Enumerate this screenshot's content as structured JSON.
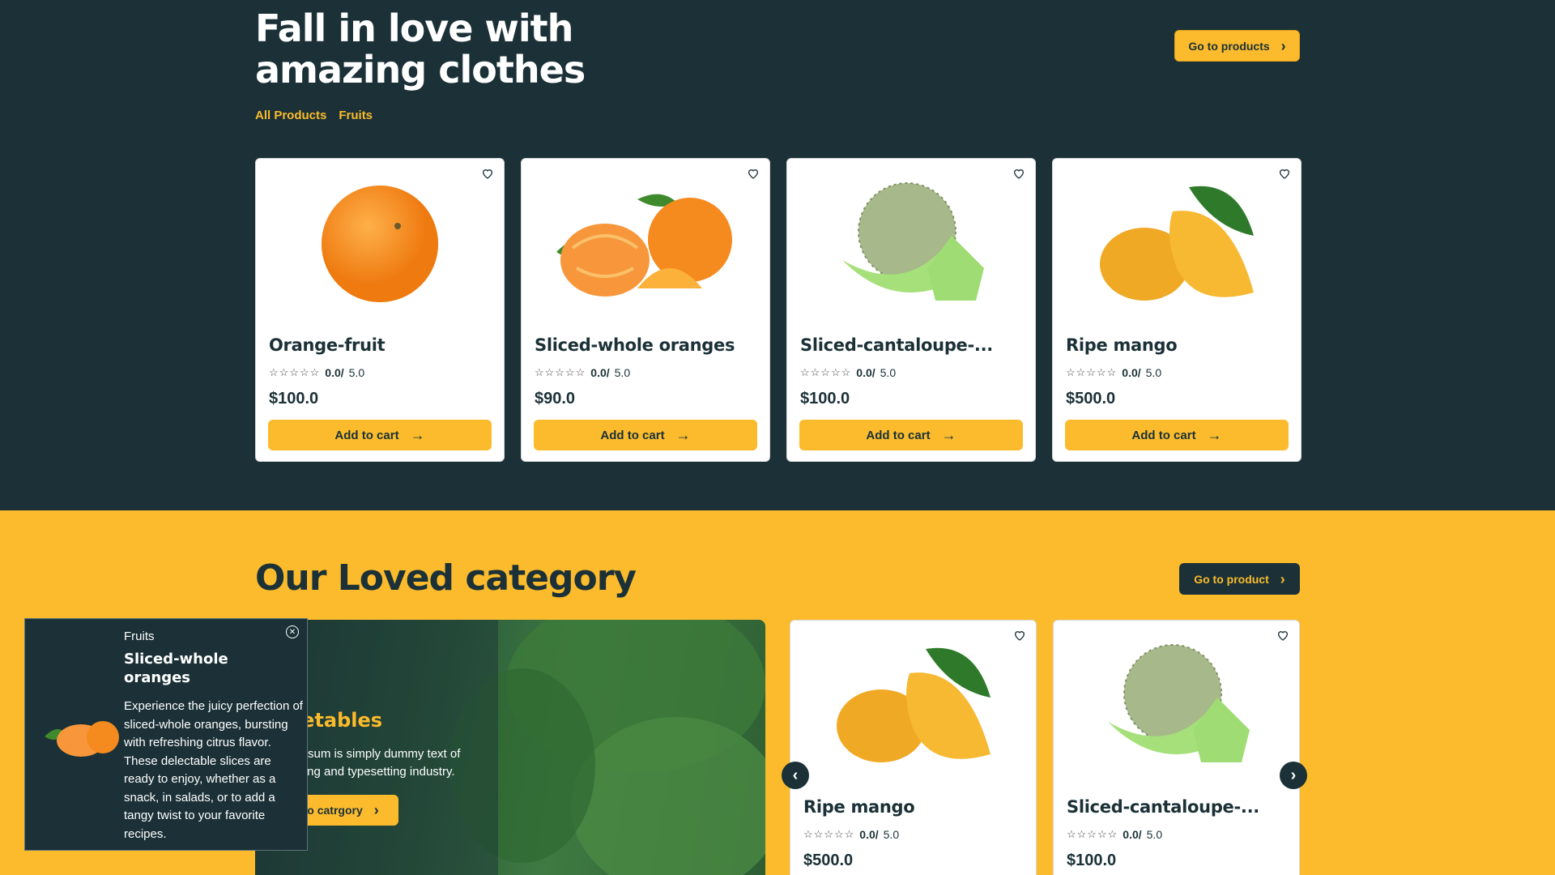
{
  "hero": {
    "title": "Fall in love with amazing clothes",
    "go_button": "Go to products",
    "filters": [
      "All Products",
      "Fruits"
    ]
  },
  "products": [
    {
      "name": "Orange-fruit",
      "stars": "☆☆☆☆☆",
      "rating": "0.0/",
      "rating_max": "5.0",
      "price": "$100.0",
      "button": "Add to cart",
      "image": "orange-image"
    },
    {
      "name": "Sliced-whole oranges",
      "stars": "☆☆☆☆☆",
      "rating": "0.0/",
      "rating_max": "5.0",
      "price": "$90.0",
      "button": "Add to cart",
      "image": "sliced-oranges-image"
    },
    {
      "name": "Sliced-cantaloupe-...",
      "stars": "☆☆☆☆☆",
      "rating": "0.0/",
      "rating_max": "5.0",
      "price": "$100.0",
      "button": "Add to cart",
      "image": "cantaloupe-image"
    },
    {
      "name": "Ripe mango",
      "stars": "☆☆☆☆☆",
      "rating": "0.0/",
      "rating_max": "5.0",
      "price": "$500.0",
      "button": "Add to cart",
      "image": "mango-image"
    }
  ],
  "category": {
    "title": "Our Loved category",
    "go_button": "Go to product",
    "banner": {
      "title": "getables",
      "text": "n Ipsum is simply dummy text of rinting and typesetting industry.",
      "button": "o catrgory"
    },
    "items": [
      {
        "name": "Ripe mango",
        "stars": "☆☆☆☆☆",
        "rating": "0.0/",
        "rating_max": "5.0",
        "price": "$500.0"
      },
      {
        "name": "Sliced-cantaloupe-...",
        "stars": "☆☆☆☆☆",
        "rating": "0.0/",
        "rating_max": "5.0",
        "price": "$100.0"
      }
    ]
  },
  "toast": {
    "category": "Fruits",
    "title": "Sliced-whole oranges",
    "description": "Experience the juicy perfection of sliced-whole oranges, bursting with refreshing citrus flavor. These delectable slices are ready to enjoy, whether as a snack, in salads, or to add a tangy twist to your favorite recipes."
  },
  "colors": {
    "dark": "#1b3137",
    "accent": "#fbbb2c"
  }
}
